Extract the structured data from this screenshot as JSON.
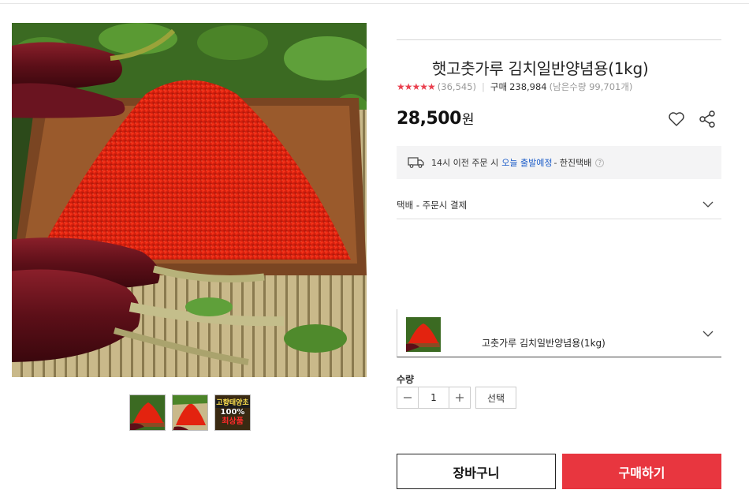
{
  "product": {
    "title": "햇고춧가루 김치일반양념용(1kg)",
    "stars": "★★★★★",
    "review_count": "(36,545)",
    "purchase_label": "구매",
    "purchase_count": "238,984",
    "stock_text": "(남은수량 99,701개)",
    "price": "28,500",
    "currency": "원",
    "rating": 5
  },
  "gallery": {
    "thumb3_line1": "고향태양초",
    "thumb3_line2": "100%",
    "thumb3_line3": "최상품"
  },
  "delivery": {
    "prefix": "14시 이전 주문 시",
    "today": "오늘 출발예정",
    "courier": "- 한진택배",
    "help": "?"
  },
  "shipping": {
    "label": "택배 - 주문시 결제"
  },
  "option": {
    "label": "고춧가루 김치일반양념용(1kg)"
  },
  "quantity": {
    "label": "수량",
    "value": "1",
    "select_label": "선택"
  },
  "actions": {
    "cart_label": "장바구니",
    "buy_label": "구매하기"
  },
  "colors": {
    "accent_red": "#e8363f",
    "star_red": "#ea3f4e",
    "link_blue": "#1e5ec9"
  },
  "icons": [
    "heart-icon",
    "share-icon",
    "truck-icon",
    "help-icon",
    "chevron-down-icon",
    "minus-icon",
    "plus-icon"
  ]
}
